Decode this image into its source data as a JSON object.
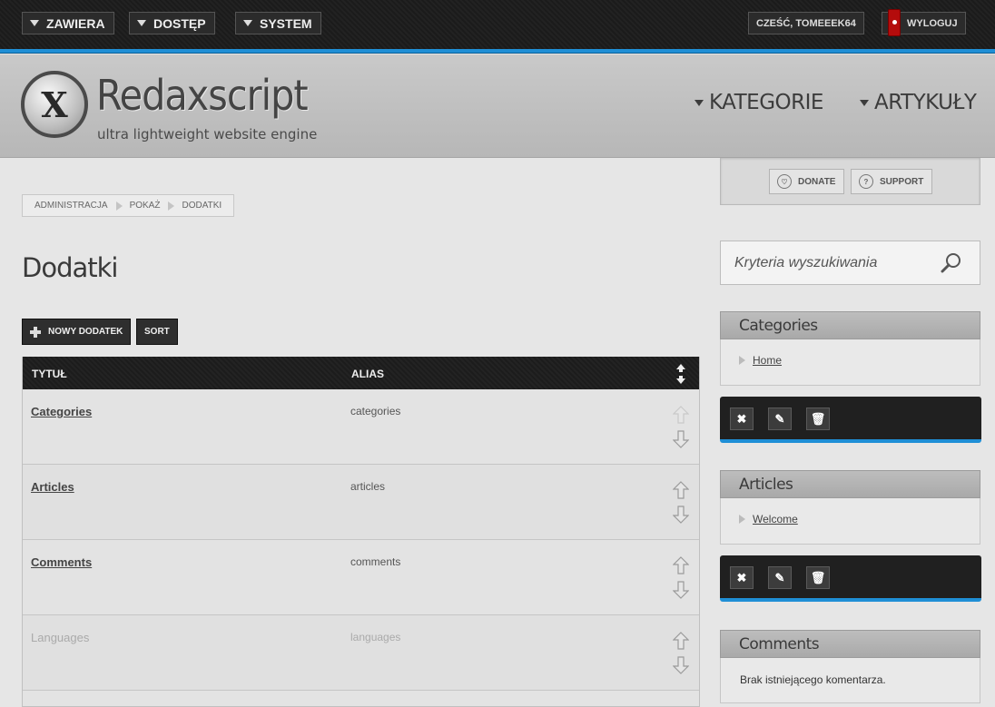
{
  "adminbar": {
    "menus": [
      "ZAWIERA",
      "DOSTĘP",
      "SYSTEM"
    ],
    "greeting": "CZEŚĆ, TOMEEEK64",
    "logout": "WYLOGUJ"
  },
  "header": {
    "logo_letter": "X",
    "brand": "Redaxscript",
    "slogan": "ultra lightweight website engine",
    "nav": [
      "KATEGORIE",
      "ARTYKUŁY"
    ]
  },
  "help": {
    "donate": "DONATE",
    "support": "SUPPORT"
  },
  "breadcrumb": [
    "ADMINISTRACJA",
    "POKAŻ",
    "DODATKI"
  ],
  "page_title": "Dodatki",
  "actions": {
    "new_label": "NOWY DODATEK",
    "sort_label": "SORT"
  },
  "table": {
    "headers": {
      "title": "TYTUŁ",
      "alias": "ALIAS"
    },
    "rows": [
      {
        "title": "Categories",
        "alias": "categories",
        "enabled": true
      },
      {
        "title": "Articles",
        "alias": "articles",
        "enabled": true
      },
      {
        "title": "Comments",
        "alias": "comments",
        "enabled": true
      },
      {
        "title": "Languages",
        "alias": "languages",
        "enabled": false
      }
    ]
  },
  "sidebar": {
    "search_placeholder": "Kryteria wyszukiwania",
    "boxes": [
      {
        "title": "Categories",
        "link": "Home"
      },
      {
        "title": "Articles",
        "link": "Welcome"
      },
      {
        "title": "Comments",
        "text": "Brak istniejącego komentarza."
      }
    ],
    "tool_icons": [
      "close-icon",
      "pencil-icon",
      "trash-icon"
    ]
  },
  "colors": {
    "accent_blue": "#1f8fd6",
    "logout_red": "#b40c0c",
    "bar_dark": "#1e1e1e"
  }
}
